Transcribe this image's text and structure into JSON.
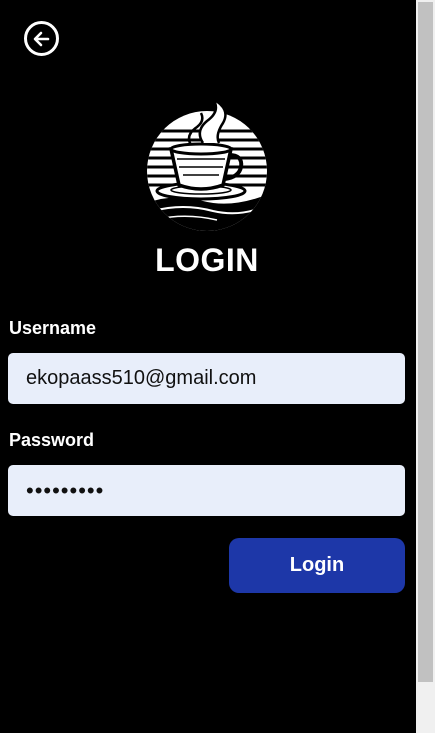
{
  "header": {
    "back_icon": "arrow-left-circle-icon"
  },
  "logo": {
    "icon": "coffee-cup-logo"
  },
  "page": {
    "title": "LOGIN"
  },
  "form": {
    "username_label": "Username",
    "username_value": "ekopaass510@gmail.com",
    "password_label": "Password",
    "password_value": "•••••••••",
    "submit_label": "Login"
  },
  "colors": {
    "background": "#000000",
    "input_background": "#e8eefa",
    "button": "#1d37a8",
    "text": "#ffffff"
  }
}
